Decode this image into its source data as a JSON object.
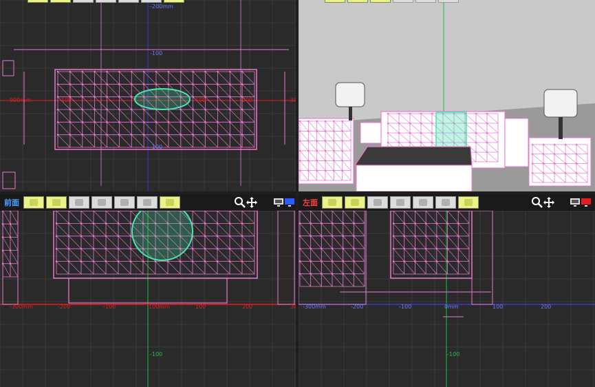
{
  "viewports": {
    "top": {
      "ruler_labels": [
        "-200mm",
        "-100",
        "-100",
        "900mm",
        "-100",
        "100",
        "200",
        "300"
      ],
      "axis_color": "#e02020"
    },
    "front": {
      "name": "前面",
      "name_color": "#4aa0ff",
      "ruler_labels": [
        "-300mm",
        "-200",
        "-100",
        "100mm",
        "100",
        "200",
        "300",
        "-100"
      ],
      "tool_icons": [
        "zoom-icon",
        "pan-icon",
        "monitor-icon"
      ]
    },
    "left": {
      "name": "左面",
      "name_color": "#ff4040",
      "ruler_labels": [
        "-300mm",
        "-200",
        "-100",
        "0mm",
        "100",
        "200",
        "-100"
      ],
      "tool_icons": [
        "zoom-icon",
        "pan-icon",
        "monitor-icon"
      ]
    },
    "perspective": {
      "background": "#c9c9c9"
    }
  },
  "colors": {
    "wire": "#e87ad0",
    "selected": "#49e6b0",
    "grid_major": "#3a3a3a",
    "grid_minor": "#2e2e2e",
    "toolbar_yellow": "#eaf28a"
  }
}
